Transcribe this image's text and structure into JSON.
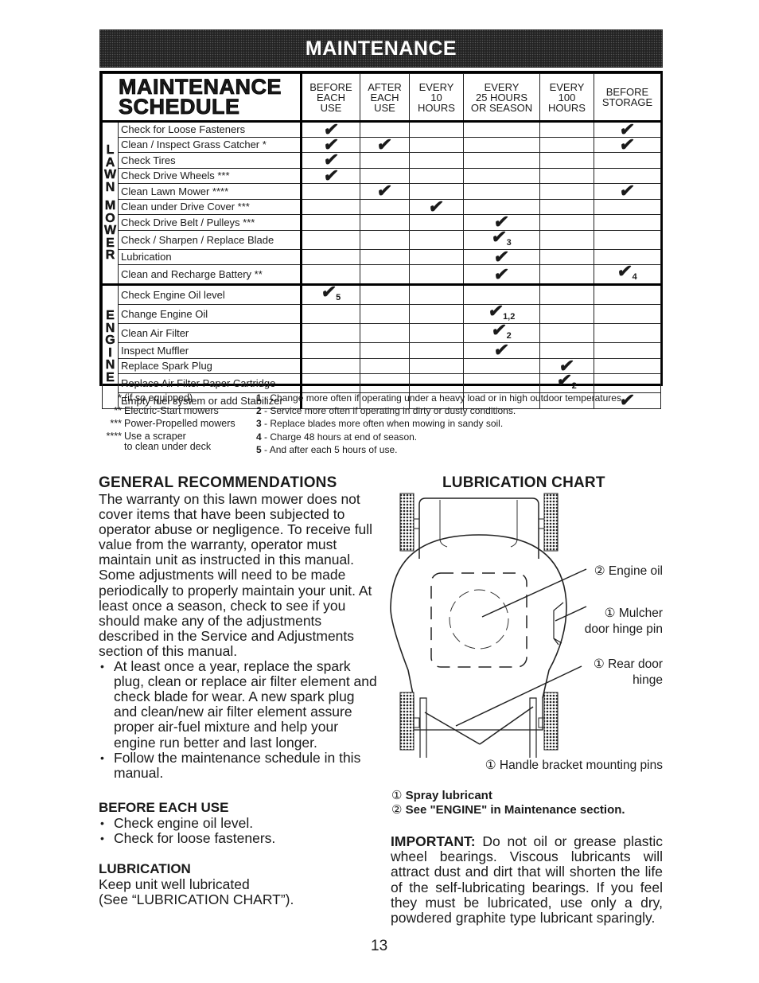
{
  "banner": {
    "title": "MAINTENANCE"
  },
  "schedule": {
    "title_line1": "MAINTENANCE",
    "title_line2": "SCHEDULE",
    "columns": [
      {
        "line1": "BEFORE",
        "line2": "EACH",
        "line3": "USE"
      },
      {
        "line1": "AFTER",
        "line2": "EACH",
        "line3": "USE"
      },
      {
        "line1": "EVERY",
        "line2": "10",
        "line3": "HOURS"
      },
      {
        "line1": "EVERY",
        "line2": "25 HOURS",
        "line3": "OR SEASON"
      },
      {
        "line1": "EVERY",
        "line2": "100",
        "line3": "HOURS"
      },
      {
        "line1": "BEFORE",
        "line2": "STORAGE",
        "line3": ""
      }
    ],
    "check_symbol": "✔",
    "groups": [
      {
        "label": "LAWN MOWER",
        "letters": [
          "L",
          "A",
          "W",
          "N",
          "",
          "M",
          "O",
          "W",
          "E",
          "R"
        ],
        "tasks": [
          {
            "name": "Check for Loose Fasteners",
            "marks": [
              "✔",
              "",
              "",
              "",
              "",
              "✔"
            ],
            "notes": [
              "",
              "",
              "",
              "",
              "",
              ""
            ]
          },
          {
            "name": "Clean / Inspect Grass Catcher *",
            "marks": [
              "✔",
              "✔",
              "",
              "",
              "",
              "✔"
            ],
            "notes": [
              "",
              "",
              "",
              "",
              "",
              ""
            ]
          },
          {
            "name": "Check Tires",
            "marks": [
              "✔",
              "",
              "",
              "",
              "",
              ""
            ],
            "notes": [
              "",
              "",
              "",
              "",
              "",
              ""
            ]
          },
          {
            "name": "Check Drive Wheels ***",
            "marks": [
              "✔",
              "",
              "",
              "",
              "",
              ""
            ],
            "notes": [
              "",
              "",
              "",
              "",
              "",
              ""
            ]
          },
          {
            "name": "Clean Lawn Mower ****",
            "marks": [
              "",
              "✔",
              "",
              "",
              "",
              "✔"
            ],
            "notes": [
              "",
              "",
              "",
              "",
              "",
              ""
            ]
          },
          {
            "name": "Clean under Drive Cover ***",
            "marks": [
              "",
              "",
              "✔",
              "",
              "",
              ""
            ],
            "notes": [
              "",
              "",
              "",
              "",
              "",
              ""
            ]
          },
          {
            "name": "Check Drive Belt / Pulleys ***",
            "marks": [
              "",
              "",
              "",
              "✔",
              "",
              ""
            ],
            "notes": [
              "",
              "",
              "",
              "",
              "",
              ""
            ]
          },
          {
            "name": "Check / Sharpen / Replace Blade",
            "marks": [
              "",
              "",
              "",
              "✔",
              "",
              ""
            ],
            "notes": [
              "",
              "",
              "",
              "3",
              "",
              ""
            ]
          },
          {
            "name": "Lubrication",
            "marks": [
              "",
              "",
              "",
              "✔",
              "",
              ""
            ],
            "notes": [
              "",
              "",
              "",
              "",
              "",
              ""
            ]
          },
          {
            "name": "Clean and Recharge Battery **",
            "marks": [
              "",
              "",
              "",
              "✔",
              "",
              "✔"
            ],
            "notes": [
              "",
              "",
              "",
              "",
              "",
              "4"
            ]
          }
        ]
      },
      {
        "label": "ENGINE",
        "letters": [
          "E",
          "N",
          "G",
          "I",
          "N",
          "E"
        ],
        "tasks": [
          {
            "name": "Check Engine Oil level",
            "marks": [
              "✔",
              "",
              "",
              "",
              "",
              ""
            ],
            "notes": [
              "5",
              "",
              "",
              "",
              "",
              ""
            ]
          },
          {
            "name": "Change Engine Oil",
            "marks": [
              "",
              "",
              "",
              "✔",
              "",
              ""
            ],
            "notes": [
              "",
              "",
              "",
              "1,2",
              "",
              ""
            ]
          },
          {
            "name": "Clean Air Filter",
            "marks": [
              "",
              "",
              "",
              "✔",
              "",
              ""
            ],
            "notes": [
              "",
              "",
              "",
              "2",
              "",
              ""
            ]
          },
          {
            "name": "Inspect Muffler",
            "marks": [
              "",
              "",
              "",
              "✔",
              "",
              ""
            ],
            "notes": [
              "",
              "",
              "",
              "",
              "",
              ""
            ]
          },
          {
            "name": "Replace Spark Plug",
            "marks": [
              "",
              "",
              "",
              "",
              "✔",
              ""
            ],
            "notes": [
              "",
              "",
              "",
              "",
              "",
              ""
            ]
          },
          {
            "name": "Replace Air Filter Paper Cartridge",
            "marks": [
              "",
              "",
              "",
              "",
              "✔",
              ""
            ],
            "notes": [
              "",
              "",
              "",
              "",
              "2",
              ""
            ]
          },
          {
            "name": "Empty fuel system or add Stabilizer",
            "marks": [
              "",
              "",
              "",
              "",
              "",
              "✔"
            ],
            "notes": [
              "",
              "",
              "",
              "",
              "",
              ""
            ]
          }
        ]
      }
    ]
  },
  "footnotes": {
    "asterisks": [
      {
        "sym": "*",
        "text": "(if so equipped)"
      },
      {
        "sym": "**",
        "text": "Electric-Start mowers"
      },
      {
        "sym": "***",
        "text": "Power-Propelled mowers"
      },
      {
        "sym": "****",
        "text": "Use a scraper"
      },
      {
        "sym": "",
        "text": "to clean under deck"
      }
    ],
    "numbered": [
      {
        "num": "1",
        "text": " - Change more often if operating under a heavy load or in high outdoor temperatures."
      },
      {
        "num": "2",
        "text": " - Service more often if operating in dirty or dusty conditions."
      },
      {
        "num": "3",
        "text": " - Replace blades more often when mowing in sandy soil."
      },
      {
        "num": "4",
        "text": " - Charge 48 hours at end of season."
      },
      {
        "num": "5",
        "text": " - And after each 5 hours of use."
      }
    ]
  },
  "general": {
    "heading": "GENERAL RECOMMENDATIONS",
    "paragraph": "The warranty on this lawn mower does not cover items that have been subjected to operator abuse or negligence.  To receive full value from the warranty, operator must maintain unit as instructed in this manual. Some adjustments will need to be made periodically to properly maintain your unit. At least once a season, check to see if you should make any of the adjustments described in the Service and Adjustments section of this manual.",
    "bullets": [
      "At least once a year, replace the spark plug, clean or replace air filter element and check blade for wear.  A new spark plug and clean/new air filter element assure proper air-fuel mixture and help your engine run better and last longer.",
      "Follow the maintenance schedule in this manual."
    ]
  },
  "before_each_use": {
    "heading": "BEFORE EACH USE",
    "bullets": [
      "Check engine oil level.",
      "Check for loose fasteners."
    ]
  },
  "lubrication": {
    "heading": "LUBRICATION",
    "line1": "Keep unit well lubricated",
    "line2": "(See “LUBRICATION CHART”)."
  },
  "lubrication_chart": {
    "title": "LUBRICATION CHART",
    "labels": {
      "engine_oil": {
        "num": "②",
        "text": "Engine oil"
      },
      "mulcher": {
        "num": "①",
        "text": "Mulcher",
        "text2": "door hinge pin"
      },
      "rear_door": {
        "num": "①",
        "text": "Rear door",
        "text2": "hinge"
      },
      "handle": {
        "num": "①",
        "text": "Handle bracket mounting pins"
      }
    },
    "legend": [
      {
        "num": "①",
        "text": "Spray lubricant"
      },
      {
        "num": "②",
        "text": "See \"ENGINE\" in Maintenance section."
      }
    ]
  },
  "important": {
    "label": "IMPORTANT:",
    "text": "  Do not oil or grease plastic wheel bearings.  Viscous lubricants will attract dust and dirt that will shorten the life of the self-lubricating bearings.  If you feel they must be lubricated, use only a dry, powdered graphite type lubricant sparingly."
  },
  "page_number": "13"
}
